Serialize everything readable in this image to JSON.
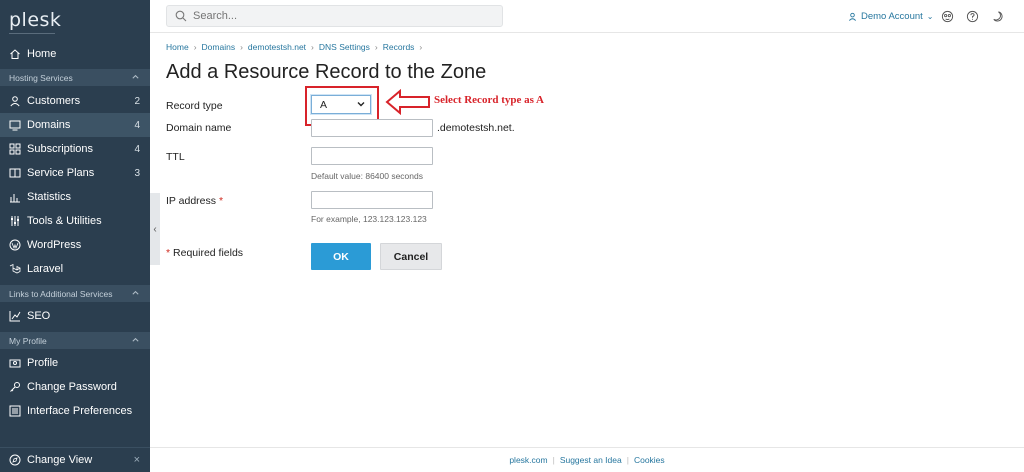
{
  "sidebar": {
    "logo": "plesk",
    "home": "Home",
    "sections": [
      {
        "label": "Hosting Services"
      },
      {
        "label": "Links to Additional Services"
      },
      {
        "label": "My Profile"
      }
    ],
    "items": [
      {
        "label": "Customers",
        "count": "2"
      },
      {
        "label": "Domains",
        "count": "4"
      },
      {
        "label": "Subscriptions",
        "count": "4"
      },
      {
        "label": "Service Plans",
        "count": "3"
      },
      {
        "label": "Statistics"
      },
      {
        "label": "Tools & Utilities"
      },
      {
        "label": "WordPress"
      },
      {
        "label": "Laravel"
      },
      {
        "label": "SEO"
      },
      {
        "label": "Profile"
      },
      {
        "label": "Change Password"
      },
      {
        "label": "Interface Preferences"
      }
    ],
    "change_view": "Change View"
  },
  "header": {
    "search_placeholder": "Search...",
    "account": "Demo Account"
  },
  "breadcrumbs": [
    "Home",
    "Domains",
    "demotestsh.net",
    "DNS Settings",
    "Records"
  ],
  "page": {
    "title": "Add a Resource Record to the Zone",
    "record_type_label": "Record type",
    "record_type_value": "A",
    "domain_name_label": "Domain name",
    "domain_suffix": ".demotestsh.net.",
    "ttl_label": "TTL",
    "ttl_hint": "Default value: 86400 seconds",
    "ip_label": "IP address",
    "required_mark": "*",
    "ip_hint": "For example, 123.123.123.123",
    "required_fields": "Required fields",
    "ok": "OK",
    "cancel": "Cancel",
    "annotation": "Select Record type as A"
  },
  "footer": {
    "links": [
      "plesk.com",
      "Suggest an Idea",
      "Cookies"
    ]
  },
  "colors": {
    "sidebar_bg": "#2b3e4f",
    "accent": "#2b9bd6",
    "link": "#27779f",
    "annotation": "#d8232a"
  }
}
